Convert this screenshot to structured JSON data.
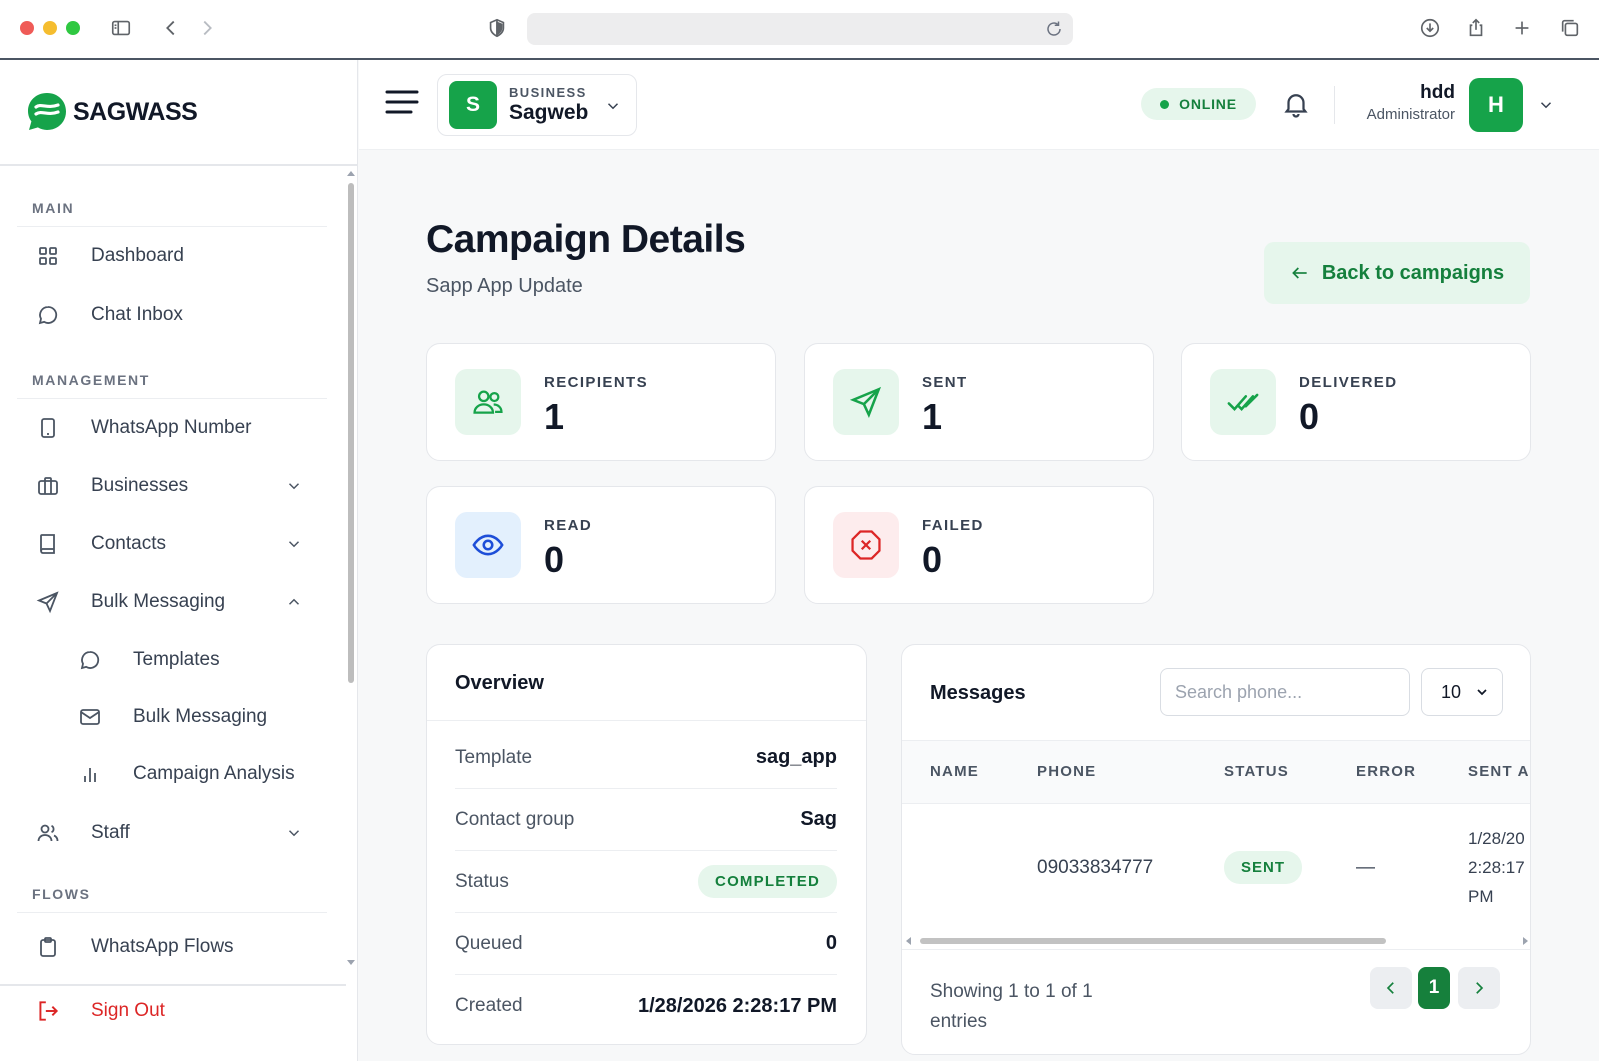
{
  "sidebar": {
    "brand": "SAGWASS",
    "sections": {
      "main": "MAIN",
      "management": "MANAGEMENT",
      "flows": "FLOWS"
    },
    "items": {
      "dashboard": "Dashboard",
      "chat_inbox": "Chat Inbox",
      "whatsapp_number": "WhatsApp Number",
      "businesses": "Businesses",
      "contacts": "Contacts",
      "bulk_messaging": "Bulk Messaging",
      "templates": "Templates",
      "bulk_messaging_sub": "Bulk Messaging",
      "campaign_analysis": "Campaign Analysis",
      "staff": "Staff",
      "whatsapp_flows": "WhatsApp Flows"
    },
    "sign_out": "Sign Out"
  },
  "topbar": {
    "business_kicker": "BUSINESS",
    "business_name": "Sagweb",
    "business_initial": "S",
    "status": "ONLINE",
    "user_name": "hdd",
    "user_role": "Administrator",
    "user_initial": "H"
  },
  "page": {
    "title": "Campaign Details",
    "subtitle": "Sapp App Update",
    "back_label": "Back to campaigns"
  },
  "stats": {
    "recipients": {
      "label": "RECIPIENTS",
      "value": "1"
    },
    "sent": {
      "label": "SENT",
      "value": "1"
    },
    "delivered": {
      "label": "DELIVERED",
      "value": "0"
    },
    "read": {
      "label": "READ",
      "value": "0"
    },
    "failed": {
      "label": "FAILED",
      "value": "0"
    }
  },
  "overview": {
    "title": "Overview",
    "rows": {
      "template": {
        "key": "Template",
        "value": "sag_app"
      },
      "contact_group": {
        "key": "Contact group",
        "value": "Sag"
      },
      "status": {
        "key": "Status",
        "value": "COMPLETED"
      },
      "queued": {
        "key": "Queued",
        "value": "0"
      },
      "created": {
        "key": "Created",
        "value": "1/28/2026 2:28:17 PM"
      }
    }
  },
  "messages": {
    "title": "Messages",
    "search_placeholder": "Search phone...",
    "page_size": "10",
    "columns": {
      "name": "NAME",
      "phone": "PHONE",
      "status": "STATUS",
      "error": "ERROR",
      "sent_at": "SENT A"
    },
    "rows": [
      {
        "name": "",
        "phone": "09033834777",
        "status": "SENT",
        "error": "—",
        "sent_line1": "1/28/20",
        "sent_line2": "2:28:17",
        "sent_line3": "PM"
      }
    ],
    "showing": "Showing 1 to 1 of 1 entries",
    "current_page": "1"
  },
  "colors": {
    "accent": "#16a34a",
    "accent_soft": "#e6f6ec",
    "danger": "#dc2626",
    "read_blue": "#2563eb"
  }
}
